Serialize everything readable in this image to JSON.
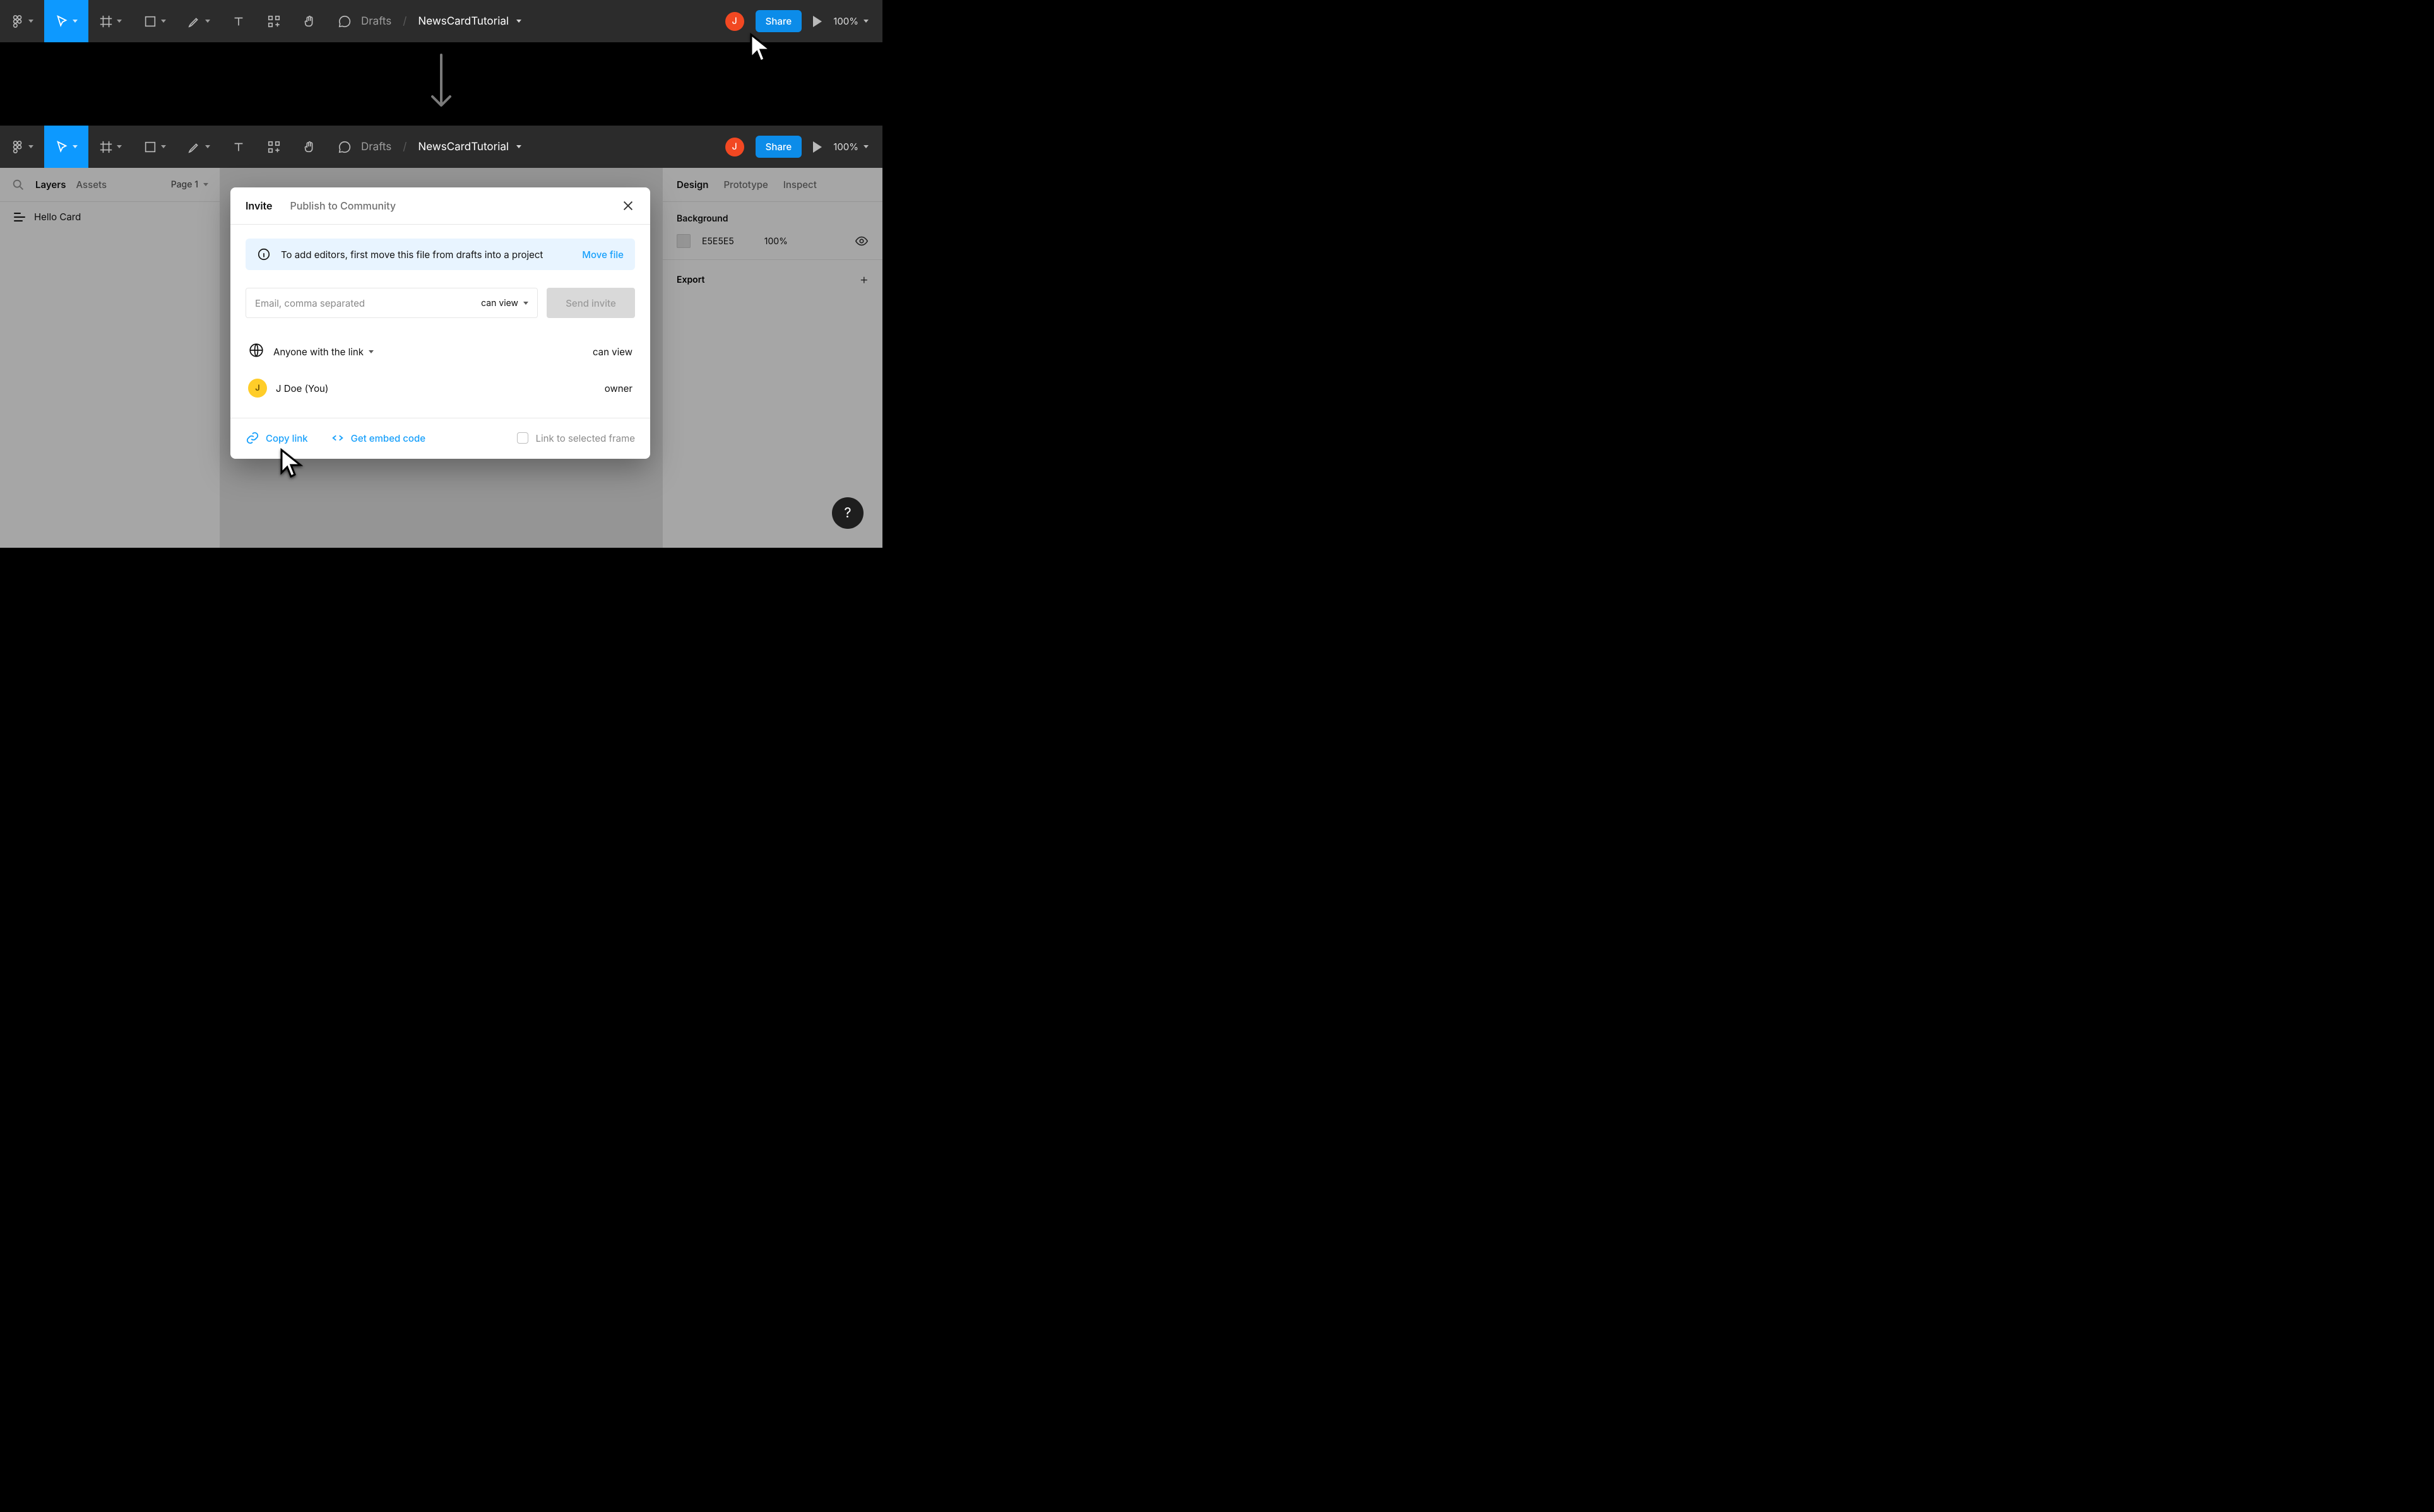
{
  "top_toolbar": {
    "breadcrumb_drafts": "Drafts",
    "breadcrumb_sep": "/",
    "file_name": "NewsCardTutorial",
    "avatar_initial": "J",
    "share_label": "Share",
    "zoom_label": "100%"
  },
  "bottom_toolbar": {
    "breadcrumb_drafts": "Drafts",
    "breadcrumb_sep": "/",
    "file_name": "NewsCardTutorial",
    "avatar_initial": "J",
    "share_label": "Share",
    "zoom_label": "100%"
  },
  "left_panel": {
    "tab_layers": "Layers",
    "tab_assets": "Assets",
    "page_label": "Page 1",
    "layer_items": [
      {
        "name": "Hello Card"
      }
    ]
  },
  "right_panel": {
    "tab_design": "Design",
    "tab_prototype": "Prototype",
    "tab_inspect": "Inspect",
    "bg_section_title": "Background",
    "bg_hex": "E5E5E5",
    "bg_opacity": "100%",
    "export_label": "Export"
  },
  "share_modal": {
    "tab_invite": "Invite",
    "tab_publish": "Publish to Community",
    "banner_text": "To add editors, first move this file from drafts into a project",
    "banner_action": "Move file",
    "email_placeholder": "Email, comma separated",
    "perm_label": "can view",
    "send_label": "Send invite",
    "link_scope": "Anyone with the link",
    "link_role": "can view",
    "member_name": "J Doe (You)",
    "member_initial": "J",
    "member_role": "owner",
    "copy_link": "Copy link",
    "embed_code": "Get embed code",
    "frame_checkbox": "Link to selected frame"
  },
  "help_label": "?"
}
